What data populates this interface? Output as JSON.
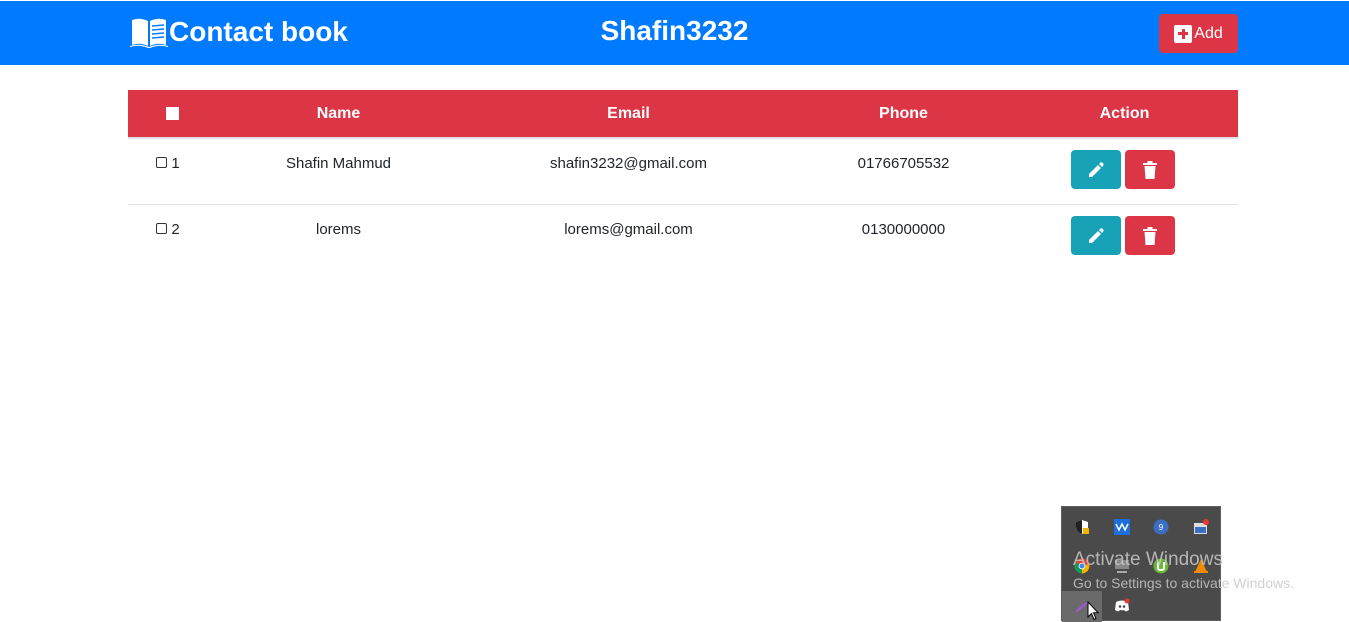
{
  "header": {
    "brand": "Contact book",
    "user": "Shafin3232",
    "add_label": "Add",
    "bg_color": "#007bff"
  },
  "table": {
    "columns": [
      "",
      "Name",
      "Email",
      "Phone",
      "Action"
    ],
    "header_color": "#dc3545",
    "rows": [
      {
        "index": "1",
        "name": "Shafin Mahmud",
        "email": "shafin3232@gmail.com",
        "phone": "01766705532"
      },
      {
        "index": "2",
        "name": "lorems",
        "email": "lorems@gmail.com",
        "phone": "0130000000"
      }
    ],
    "edit_color": "#17a2b8",
    "delete_color": "#dc3545"
  },
  "tray": {
    "icons": [
      "shield-icon",
      "network-meter-icon",
      "badge-9-icon",
      "screen-tool-icon",
      "chrome-icon",
      "display-icon",
      "utorrent-icon",
      "vlc-icon",
      "feather-icon",
      "discord-icon"
    ]
  },
  "watermark": {
    "line1": "Activate Windows",
    "line2": "Go to Settings to activate Windows."
  }
}
